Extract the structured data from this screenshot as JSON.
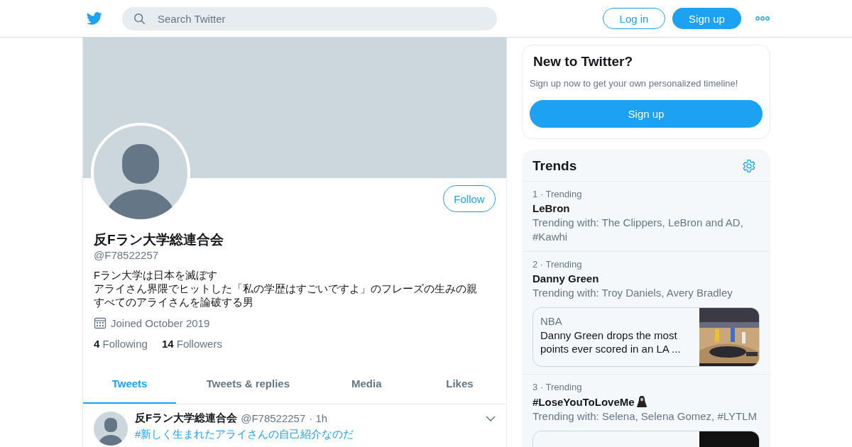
{
  "header": {
    "search_placeholder": "Search Twitter",
    "login": "Log in",
    "signup": "Sign up"
  },
  "profile": {
    "name": "反Fラン大学総連合会",
    "handle": "@F78522257",
    "follow_button": "Follow",
    "bio": [
      "Fラン大学は日本を滅ぼす",
      "アライさん界隈でヒットした「私の学歴はすごいですよ」のフレーズの生みの親",
      "すべてのアライさんを論破する男"
    ],
    "joined": "Joined October 2019",
    "following_count": "4",
    "following_label": "Following",
    "followers_count": "14",
    "followers_label": "Followers"
  },
  "tabs": [
    {
      "label": "Tweets",
      "selected": true
    },
    {
      "label": "Tweets & replies",
      "selected": false
    },
    {
      "label": "Media",
      "selected": false
    },
    {
      "label": "Likes",
      "selected": false
    }
  ],
  "tweets": [
    {
      "name": "反Fラン大学総連合会",
      "handle": "@F78522257",
      "time": "· 1h",
      "text": "#新しく生まれたアライさんの自己紹介なのだ"
    }
  ],
  "signup_card": {
    "title": "New to Twitter?",
    "text": "Sign up now to get your own personalized timeline!",
    "button": "Sign up"
  },
  "trends": {
    "title": "Trends",
    "items": [
      {
        "rank": "1",
        "context": "· Trending",
        "name": "LeBron",
        "with": "Trending with: The Clippers, LeBron and AD, #Kawhi",
        "has_icon": false
      },
      {
        "rank": "2",
        "context": "· Trending",
        "name": "Danny Green",
        "with": "Trending with: Troy Daniels, Avery Bradley",
        "has_icon": false,
        "card": {
          "kind": "news",
          "source": "NBA",
          "headline": "Danny Green drops the most points ever scored in an LA ..."
        }
      },
      {
        "rank": "3",
        "context": "· Trending",
        "name": "#LoseYouToLoveMe",
        "with": "Trending with: Selena, Selena Gomez, #LYTLM",
        "has_icon": true
      }
    ]
  }
}
